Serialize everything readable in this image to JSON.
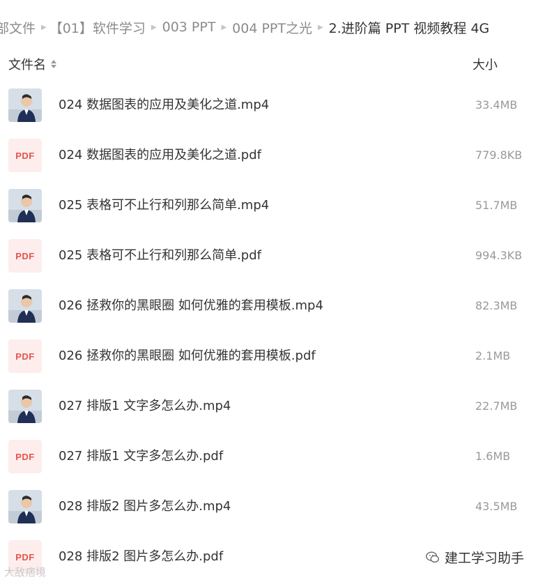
{
  "breadcrumb": {
    "items": [
      "部文件",
      "【01】软件学习",
      "003 PPT",
      "004 PPT之光",
      "2.进阶篇 PPT 视频教程 4G"
    ],
    "separator": "▶"
  },
  "columns": {
    "name": "文件名",
    "size": "大小"
  },
  "files": [
    {
      "type": "video",
      "name": "024 数据图表的应用及美化之道.mp4",
      "size": "33.4MB"
    },
    {
      "type": "pdf",
      "icon_label": "PDF",
      "name": "024 数据图表的应用及美化之道.pdf",
      "size": "779.8KB"
    },
    {
      "type": "video",
      "name": "025 表格可不止行和列那么简单.mp4",
      "size": "51.7MB"
    },
    {
      "type": "pdf",
      "icon_label": "PDF",
      "name": "025 表格可不止行和列那么简单.pdf",
      "size": "994.3KB"
    },
    {
      "type": "video",
      "name": "026 拯救你的黑眼圈 如何优雅的套用模板.mp4",
      "size": "82.3MB"
    },
    {
      "type": "pdf",
      "icon_label": "PDF",
      "name": "026 拯救你的黑眼圈 如何优雅的套用模板.pdf",
      "size": "2.1MB"
    },
    {
      "type": "video",
      "name": "027 排版1 文字多怎么办.mp4",
      "size": "22.7MB"
    },
    {
      "type": "pdf",
      "icon_label": "PDF",
      "name": "027 排版1 文字多怎么办.pdf",
      "size": "1.6MB"
    },
    {
      "type": "video",
      "name": "028 排版2 图片多怎么办.mp4",
      "size": "43.5MB"
    },
    {
      "type": "pdf",
      "icon_label": "PDF",
      "name": "028 排版2 图片多怎么办.pdf",
      "size": ""
    }
  ],
  "watermarks": {
    "left": "大敌痞境",
    "right": "建工学习助手"
  },
  "colors": {
    "pdf_red": "#e5534b",
    "pdf_bg": "#fdeded",
    "muted": "#999999",
    "text": "#333333"
  }
}
